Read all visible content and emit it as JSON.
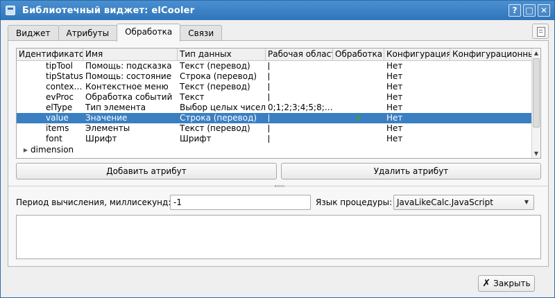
{
  "window": {
    "title": "Библиотечный виджет: elCooler",
    "buttons": {
      "help": "?",
      "maximize": "□",
      "close": "✕"
    }
  },
  "tabs": [
    {
      "label": "Виджет"
    },
    {
      "label": "Атрибуты"
    },
    {
      "label": "Обработка"
    },
    {
      "label": "Связи"
    }
  ],
  "table": {
    "columns": [
      "Идентификатор",
      "Имя",
      "Тип данных",
      "Рабочая область",
      "Обработка",
      "Конфигурация",
      "Конфигурационные данные"
    ],
    "rows": [
      {
        "id": "tipTool",
        "name": "Помощь: подсказка",
        "type": "Текст (перевод)",
        "work": "",
        "proc": "",
        "cfg": "Нет"
      },
      {
        "id": "tipStatus",
        "name": "Помощь: состояние",
        "type": "Строка (перевод)",
        "work": "",
        "proc": "",
        "cfg": "Нет"
      },
      {
        "id": "contex…",
        "name": "Контекстное меню",
        "type": "Текст (перевод)",
        "work": "",
        "proc": "",
        "cfg": "Нет"
      },
      {
        "id": "evProc",
        "name": "Обработка событий",
        "type": "Текст",
        "work": "",
        "proc": "",
        "cfg": "Нет"
      },
      {
        "id": "elType",
        "name": "Тип элемента",
        "type": "Выбор целых чисел",
        "work": "0;1;2;3;4;5;8;…",
        "proc": "",
        "cfg": "Нет"
      },
      {
        "id": "value",
        "name": "Значение",
        "type": "Строка (перевод)",
        "work": "",
        "proc": "✔",
        "cfg": "Нет"
      },
      {
        "id": "items",
        "name": "Элементы",
        "type": "Текст (перевод)",
        "work": "",
        "proc": "",
        "cfg": "Нет"
      },
      {
        "id": "font",
        "name": "Шрифт",
        "type": "Шрифт",
        "work": "",
        "proc": "",
        "cfg": "Нет"
      }
    ],
    "group_row": "dimension"
  },
  "buttons": {
    "add_attribute": "Добавить атрибут",
    "remove_attribute": "Удалить атрибут",
    "close": "Закрыть"
  },
  "form": {
    "period_label": "Период вычисления, миллисекунд:",
    "period_value": "-1",
    "language_label": "Язык процедуры:",
    "language_value": "JavaLikeCalc.JavaScript"
  },
  "colors": {
    "title_bar": "#2f75ba",
    "selection": "#3a7fc2",
    "check": "#3aa81d"
  }
}
